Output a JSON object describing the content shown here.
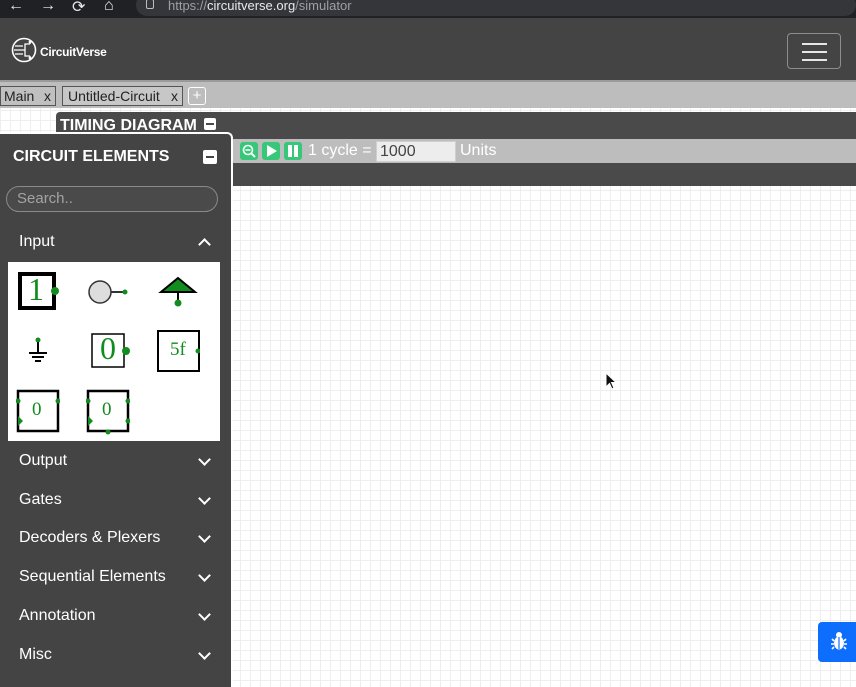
{
  "browser": {
    "url_scheme": "https://",
    "url_host": "circuitverse.org",
    "url_path": "/simulator"
  },
  "navbar": {
    "brand": "CircuitVerse"
  },
  "tabs": [
    {
      "label": "Main",
      "close": "x"
    },
    {
      "label": "Untitled-Circuit",
      "close": "x"
    }
  ],
  "add_tab": "+",
  "timing": {
    "title": "TIMING DIAGRAM",
    "cycle_label": "1 cycle =",
    "cycle_value": "1000",
    "units": "Units"
  },
  "panel": {
    "title": "CIRCUIT ELEMENTS",
    "search_placeholder": "Search..",
    "categories": [
      {
        "label": "Input",
        "expanded": true
      },
      {
        "label": "Output"
      },
      {
        "label": "Gates"
      },
      {
        "label": "Decoders & Plexers"
      },
      {
        "label": "Sequential Elements"
      },
      {
        "label": "Annotation"
      },
      {
        "label": "Misc"
      }
    ],
    "input_tiles": {
      "input_value": "1",
      "constant_value": "0",
      "stepper_value": "5f",
      "random_value": "0",
      "counter_value": "0"
    }
  },
  "colors": {
    "panel_bg": "#444444",
    "accent_green": "#36c878",
    "tile_green": "#118c1f",
    "bug_blue": "#0d6efd"
  }
}
